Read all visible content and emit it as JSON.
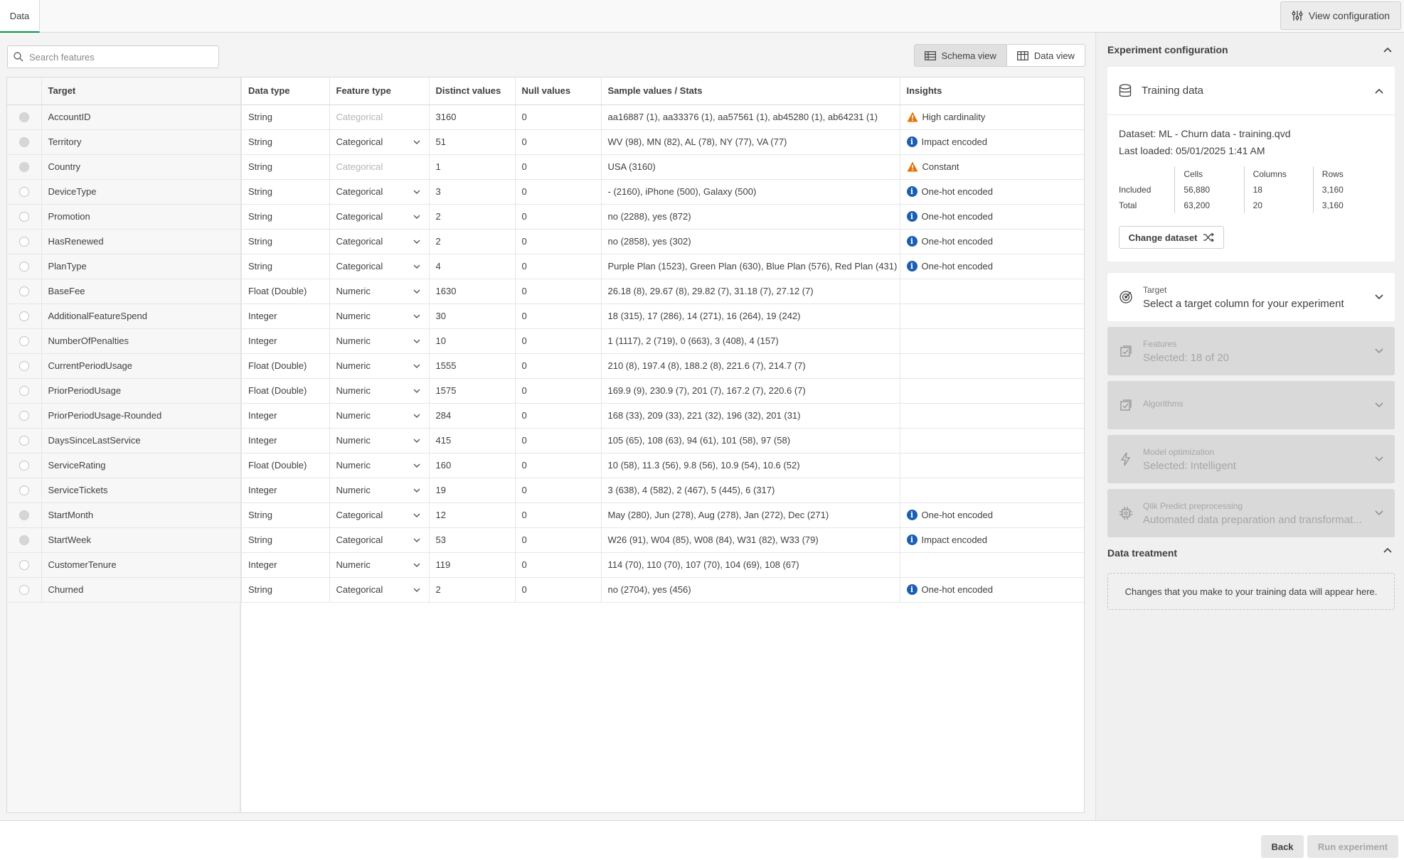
{
  "tabs": [
    {
      "label": "Data"
    }
  ],
  "header": {
    "view_config_label": "View configuration"
  },
  "search": {
    "placeholder": "Search features"
  },
  "view_toggle": {
    "schema_label": "Schema view",
    "data_label": "Data view",
    "active": "Schema view"
  },
  "table": {
    "columns": [
      "Target",
      "Data type",
      "Feature type",
      "Distinct values",
      "Null values",
      "Sample values / Stats",
      "Insights"
    ],
    "rows": [
      {
        "name": "AccountID",
        "data_type": "String",
        "feature_type": "Categorical",
        "ft_disabled": true,
        "distinct": "3160",
        "nulls": "0",
        "sample": "aa16887 (1), aa33376 (1), aa57561 (1), ab45280 (1), ab64231 (1)",
        "insight": "High cardinality",
        "insight_icon": "warning-icon",
        "radio_disabled": true
      },
      {
        "name": "Territory",
        "data_type": "String",
        "feature_type": "Categorical",
        "ft_disabled": false,
        "distinct": "51",
        "nulls": "0",
        "sample": "WV (98), MN (82), AL (78), NY (77), VA (77)",
        "insight": "Impact encoded",
        "insight_icon": "info-icon",
        "radio_disabled": true
      },
      {
        "name": "Country",
        "data_type": "String",
        "feature_type": "Categorical",
        "ft_disabled": true,
        "distinct": "1",
        "nulls": "0",
        "sample": "USA (3160)",
        "insight": "Constant",
        "insight_icon": "warning-icon",
        "radio_disabled": true
      },
      {
        "name": "DeviceType",
        "data_type": "String",
        "feature_type": "Categorical",
        "ft_disabled": false,
        "distinct": "3",
        "nulls": "0",
        "sample": "- (2160), iPhone (500), Galaxy (500)",
        "insight": "One-hot encoded",
        "insight_icon": "info-icon",
        "radio_disabled": false
      },
      {
        "name": "Promotion",
        "data_type": "String",
        "feature_type": "Categorical",
        "ft_disabled": false,
        "distinct": "2",
        "nulls": "0",
        "sample": "no (2288), yes (872)",
        "insight": "One-hot encoded",
        "insight_icon": "info-icon",
        "radio_disabled": false
      },
      {
        "name": "HasRenewed",
        "data_type": "String",
        "feature_type": "Categorical",
        "ft_disabled": false,
        "distinct": "2",
        "nulls": "0",
        "sample": "no (2858), yes (302)",
        "insight": "One-hot encoded",
        "insight_icon": "info-icon",
        "radio_disabled": false
      },
      {
        "name": "PlanType",
        "data_type": "String",
        "feature_type": "Categorical",
        "ft_disabled": false,
        "distinct": "4",
        "nulls": "0",
        "sample": "Purple Plan (1523), Green Plan (630), Blue Plan (576), Red Plan (431)",
        "insight": "One-hot encoded",
        "insight_icon": "info-icon",
        "radio_disabled": false
      },
      {
        "name": "BaseFee",
        "data_type": "Float (Double)",
        "feature_type": "Numeric",
        "ft_disabled": false,
        "distinct": "1630",
        "nulls": "0",
        "sample": "26.18 (8), 29.67 (8), 29.82 (7), 31.18 (7), 27.12 (7)",
        "insight": "",
        "insight_icon": "",
        "radio_disabled": false
      },
      {
        "name": "AdditionalFeatureSpend",
        "data_type": "Integer",
        "feature_type": "Numeric",
        "ft_disabled": false,
        "distinct": "30",
        "nulls": "0",
        "sample": "18 (315), 17 (286), 14 (271), 16 (264), 19 (242)",
        "insight": "",
        "insight_icon": "",
        "radio_disabled": false
      },
      {
        "name": "NumberOfPenalties",
        "data_type": "Integer",
        "feature_type": "Numeric",
        "ft_disabled": false,
        "distinct": "10",
        "nulls": "0",
        "sample": "1 (1117), 2 (719), 0 (663), 3 (408), 4 (157)",
        "insight": "",
        "insight_icon": "",
        "radio_disabled": false
      },
      {
        "name": "CurrentPeriodUsage",
        "data_type": "Float (Double)",
        "feature_type": "Numeric",
        "ft_disabled": false,
        "distinct": "1555",
        "nulls": "0",
        "sample": "210 (8), 197.4 (8), 188.2 (8), 221.6 (7), 214.7 (7)",
        "insight": "",
        "insight_icon": "",
        "radio_disabled": false
      },
      {
        "name": "PriorPeriodUsage",
        "data_type": "Float (Double)",
        "feature_type": "Numeric",
        "ft_disabled": false,
        "distinct": "1575",
        "nulls": "0",
        "sample": "169.9 (9), 230.9 (7), 201 (7), 167.2 (7), 220.6 (7)",
        "insight": "",
        "insight_icon": "",
        "radio_disabled": false
      },
      {
        "name": "PriorPeriodUsage-Rounded",
        "data_type": "Integer",
        "feature_type": "Numeric",
        "ft_disabled": false,
        "distinct": "284",
        "nulls": "0",
        "sample": "168 (33), 209 (33), 221 (32), 196 (32), 201 (31)",
        "insight": "",
        "insight_icon": "",
        "radio_disabled": false
      },
      {
        "name": "DaysSinceLastService",
        "data_type": "Integer",
        "feature_type": "Numeric",
        "ft_disabled": false,
        "distinct": "415",
        "nulls": "0",
        "sample": "105 (65), 108 (63), 94 (61), 101 (58), 97 (58)",
        "insight": "",
        "insight_icon": "",
        "radio_disabled": false
      },
      {
        "name": "ServiceRating",
        "data_type": "Float (Double)",
        "feature_type": "Numeric",
        "ft_disabled": false,
        "distinct": "160",
        "nulls": "0",
        "sample": "10 (58), 11.3 (56), 9.8 (56), 10.9 (54), 10.6 (52)",
        "insight": "",
        "insight_icon": "",
        "radio_disabled": false
      },
      {
        "name": "ServiceTickets",
        "data_type": "Integer",
        "feature_type": "Numeric",
        "ft_disabled": false,
        "distinct": "19",
        "nulls": "0",
        "sample": "3 (638), 4 (582), 2 (467), 5 (445), 6 (317)",
        "insight": "",
        "insight_icon": "",
        "radio_disabled": false
      },
      {
        "name": "StartMonth",
        "data_type": "String",
        "feature_type": "Categorical",
        "ft_disabled": false,
        "distinct": "12",
        "nulls": "0",
        "sample": "May (280), Jun (278), Aug (278), Jan (272), Dec (271)",
        "insight": "One-hot encoded",
        "insight_icon": "info-icon",
        "radio_disabled": true
      },
      {
        "name": "StartWeek",
        "data_type": "String",
        "feature_type": "Categorical",
        "ft_disabled": false,
        "distinct": "53",
        "nulls": "0",
        "sample": "W26 (91), W04 (85), W08 (84), W31 (82), W33 (79)",
        "insight": "Impact encoded",
        "insight_icon": "info-icon",
        "radio_disabled": true
      },
      {
        "name": "CustomerTenure",
        "data_type": "Integer",
        "feature_type": "Numeric",
        "ft_disabled": false,
        "distinct": "119",
        "nulls": "0",
        "sample": "114 (70), 110 (70), 107 (70), 104 (69), 108 (67)",
        "insight": "",
        "insight_icon": "",
        "radio_disabled": false
      },
      {
        "name": "Churned",
        "data_type": "String",
        "feature_type": "Categorical",
        "ft_disabled": false,
        "distinct": "2",
        "nulls": "0",
        "sample": "no (2704), yes (456)",
        "insight": "One-hot encoded",
        "insight_icon": "info-icon",
        "radio_disabled": false
      }
    ]
  },
  "config": {
    "title": "Experiment configuration",
    "training": {
      "title": "Training data",
      "dataset": "Dataset: ML - Churn data - training.qvd",
      "last_loaded": "Last loaded: 05/01/2025 1:41 AM",
      "stat_headers": [
        "Cells",
        "Columns",
        "Rows"
      ],
      "included_label": "Included",
      "total_label": "Total",
      "included": [
        "56,880",
        "18",
        "3,160"
      ],
      "total": [
        "63,200",
        "20",
        "3,160"
      ],
      "change_label": "Change dataset"
    },
    "sections": [
      {
        "label": "Target",
        "value": "Select a target column for your experiment",
        "enabled": true,
        "icon": "target-icon"
      },
      {
        "label": "Features",
        "value": "Selected: 18 of 20",
        "enabled": false,
        "icon": "checklist-icon"
      },
      {
        "label": "Algorithms",
        "value": "",
        "enabled": false,
        "icon": "checklist-icon"
      },
      {
        "label": "Model optimization",
        "value": "Selected: Intelligent",
        "enabled": false,
        "icon": "lightning-icon"
      },
      {
        "label": "Qlik Predict preprocessing",
        "value": "Automated data preparation and transformat...",
        "enabled": false,
        "icon": "chip-icon"
      }
    ],
    "treatment": {
      "title": "Data treatment",
      "placeholder": "Changes that you make to your training data will appear here."
    }
  },
  "footer": {
    "back_label": "Back",
    "run_label": "Run experiment"
  },
  "colors": {
    "accent": "#009845",
    "info": "#1a5fb4",
    "warning": "#e6730a"
  }
}
